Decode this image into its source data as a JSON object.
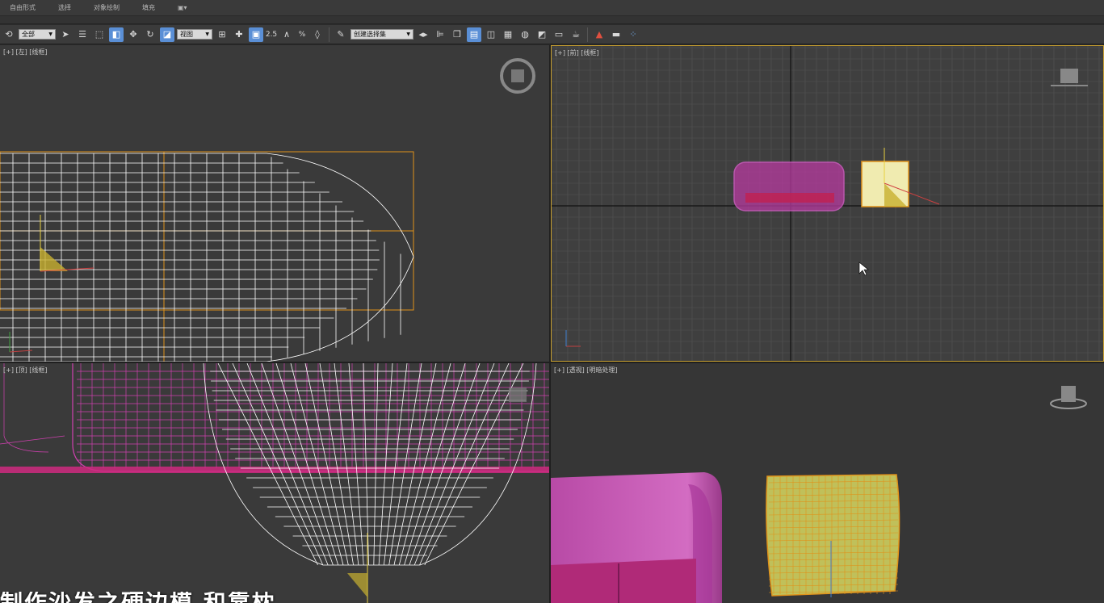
{
  "ribbon": {
    "tabs": [
      "自由形式",
      "选择",
      "对象绘制",
      "填充"
    ],
    "extra_icon": "viewport-toggle-icon"
  },
  "toolbar": {
    "selection_filter": "全部",
    "reference_coord": "视图",
    "named_selection": "创建选择集",
    "snap_angle_label": "2.5",
    "snap_percent_label": "%",
    "icons": [
      "undo-redo-icon",
      "select-object-icon",
      "select-by-name-icon",
      "rect-selection-icon",
      "window-crossing-icon",
      "move-icon",
      "rotate-icon",
      "scale-icon",
      "pivot-icon",
      "link-icon",
      "snap-3d-icon",
      "angle-snap-icon",
      "percent-snap-icon",
      "spinner-snap-icon",
      "edit-named-sets-icon",
      "mirror-icon",
      "align-icon",
      "layer-icon",
      "scene-explorer-icon",
      "curve-editor-icon",
      "schematic-view-icon",
      "material-editor-icon",
      "render-setup-icon",
      "rendered-frame-icon",
      "render-icon",
      "warning-icon",
      "ruler-icon",
      "particles-icon"
    ],
    "accent_color": "#5a8fd6"
  },
  "viewports": {
    "left": {
      "label": "[+] [左] [线框]"
    },
    "top": {
      "label": "[+] [前] [线框]"
    },
    "front": {
      "label": "[+] [顶] [线框]"
    },
    "perspective": {
      "label": "[+] [透视] [明暗处理]"
    }
  },
  "colors": {
    "wire_white": "#ffffff",
    "selection_orange": "#e0921a",
    "sofa_magenta": "#d040b0",
    "sofa_shaded": "#c24fae",
    "pillow_yellow": "#e8e070",
    "active_border": "#c8a030"
  },
  "subtitle": {
    "text": "制作沙发之硬边模 和靠枕"
  }
}
